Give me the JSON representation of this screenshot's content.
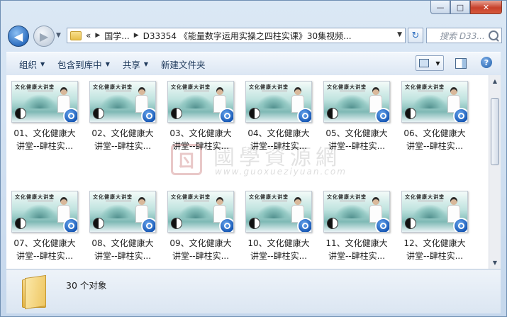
{
  "window": {
    "buttons": {
      "minimize": "—",
      "maximize": "□",
      "close": "✕"
    }
  },
  "address_bar": {
    "overflow": "«",
    "crumbs": [
      "国学...",
      "D33354 《能量数字运用实操之四柱实课》30集视频..."
    ]
  },
  "search": {
    "placeholder": "搜索 D33..."
  },
  "toolbar": {
    "organize": "组织",
    "include_in_library": "包含到库中",
    "share": "共享",
    "new_folder": "新建文件夹"
  },
  "thumbnail": {
    "title_text": "文化健康大讲堂"
  },
  "files": [
    {
      "line1": "01、文化健康大",
      "line2": "讲堂--肆柱实..."
    },
    {
      "line1": "02、文化健康大",
      "line2": "讲堂--肆柱实..."
    },
    {
      "line1": "03、文化健康大",
      "line2": "讲堂--肆柱实..."
    },
    {
      "line1": "04、文化健康大",
      "line2": "讲堂--肆柱实..."
    },
    {
      "line1": "05、文化健康大",
      "line2": "讲堂--肆柱实..."
    },
    {
      "line1": "06、文化健康大",
      "line2": "讲堂--肆柱实..."
    },
    {
      "line1": "07、文化健康大",
      "line2": "讲堂--肆柱实..."
    },
    {
      "line1": "08、文化健康大",
      "line2": "讲堂--肆柱实..."
    },
    {
      "line1": "09、文化健康大",
      "line2": "讲堂--肆柱实..."
    },
    {
      "line1": "10、文化健康大",
      "line2": "讲堂--肆柱实..."
    },
    {
      "line1": "11、文化健康大",
      "line2": "讲堂--肆柱实..."
    },
    {
      "line1": "12、文化健康大",
      "line2": "讲堂--肆柱实..."
    }
  ],
  "watermark": {
    "seal": "ㄖ",
    "name": "國學資源網",
    "url": "www.guoxueziyuan.com"
  },
  "details": {
    "count": "30 个对象"
  }
}
